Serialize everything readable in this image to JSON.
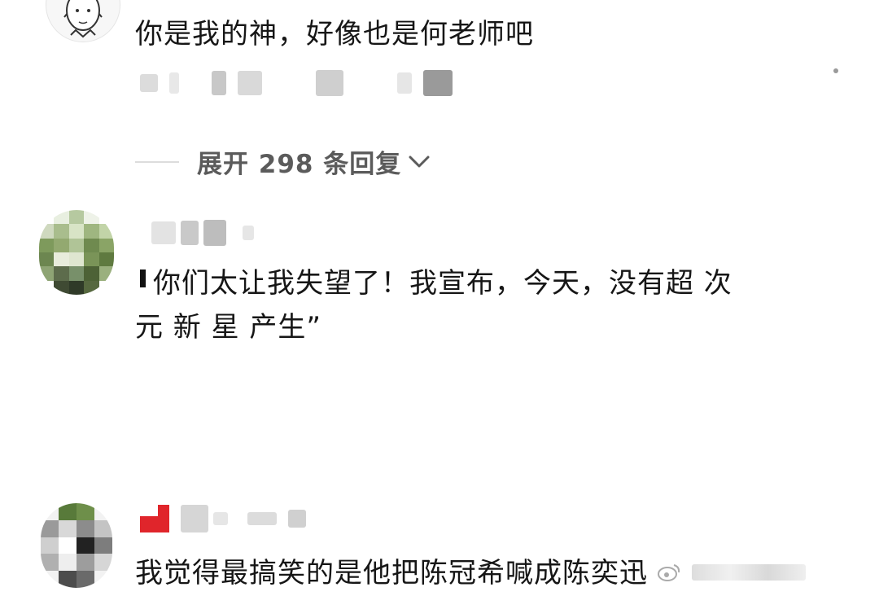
{
  "comments": [
    {
      "id": "c1",
      "text": "你是我的神，好像也是何老师吧"
    },
    {
      "id": "c2",
      "text_line1": "你们太让我失望了！我宣布，今天，没有超 次",
      "text_line2": "元 新 星 产生”"
    },
    {
      "id": "c3",
      "text": "我觉得最搞笑的是他把陈冠希喊成陈奕迅"
    }
  ],
  "expand_replies": {
    "label": "展开 298 条回复",
    "icon": "chevron-down-icon"
  },
  "colors": {
    "text": "#161616",
    "secondary": "#5b5b5b",
    "divider": "#dcdcdc",
    "badge_red": "#e0252b"
  }
}
